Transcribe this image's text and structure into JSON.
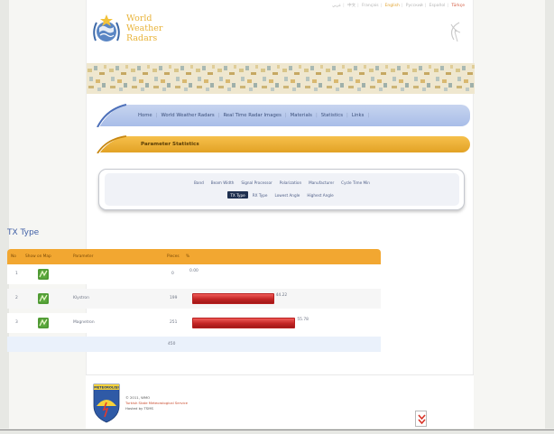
{
  "languages": [
    {
      "label": "عربي",
      "state": "normal"
    },
    {
      "label": "中文",
      "state": "normal"
    },
    {
      "label": "Français",
      "state": "normal"
    },
    {
      "label": "English",
      "state": "active"
    },
    {
      "label": "Русский",
      "state": "normal"
    },
    {
      "label": "Español",
      "state": "normal"
    },
    {
      "label": "Türkçe",
      "state": "red"
    }
  ],
  "logo": {
    "line1": "World",
    "line2": "Weather",
    "line3": "Radars"
  },
  "nav": [
    {
      "label": "Home"
    },
    {
      "label": "World Weather Radars"
    },
    {
      "label": "Real Time Radar Images"
    },
    {
      "label": "Materials"
    },
    {
      "label": "Statistics"
    },
    {
      "label": "Links"
    }
  ],
  "section_title": "Parameter Statistics",
  "tabs": {
    "row1": [
      "Band",
      "Beam Width",
      "Signal Processor",
      "Polarization",
      "Manufacturer",
      "Cycle Time Min"
    ],
    "row2": [
      "TX Type",
      "RX Type",
      "Lowest Angle",
      "Highest Angle"
    ],
    "active": "TX Type"
  },
  "page_heading": "TX Type",
  "table": {
    "headers": {
      "no": "No",
      "map": "Show on Map",
      "parameter": "Parameter",
      "pieces": "Pieces",
      "percent": "%"
    },
    "rows": [
      {
        "no": "1",
        "parameter": "",
        "pieces": "0",
        "percent": 0.0,
        "percent_label": "0.00"
      },
      {
        "no": "2",
        "parameter": "Klystron",
        "pieces": "199",
        "percent": 44.22,
        "percent_label": "44.22"
      },
      {
        "no": "3",
        "parameter": "Magnetron",
        "pieces": "251",
        "percent": 55.78,
        "percent_label": "55.78"
      }
    ],
    "total": "450"
  },
  "footer": {
    "badge": "METEOROLOJI",
    "copyright": "© 2011, WMO",
    "service": "Turkish State Meteorological Service",
    "hosted": "Hosted by TSMS"
  },
  "colors": {
    "accent_orange": "#f2a731",
    "nav_blue": "#b5c6eb",
    "bar_red": "#c32424",
    "heading_blue": "#3f5fa5"
  }
}
